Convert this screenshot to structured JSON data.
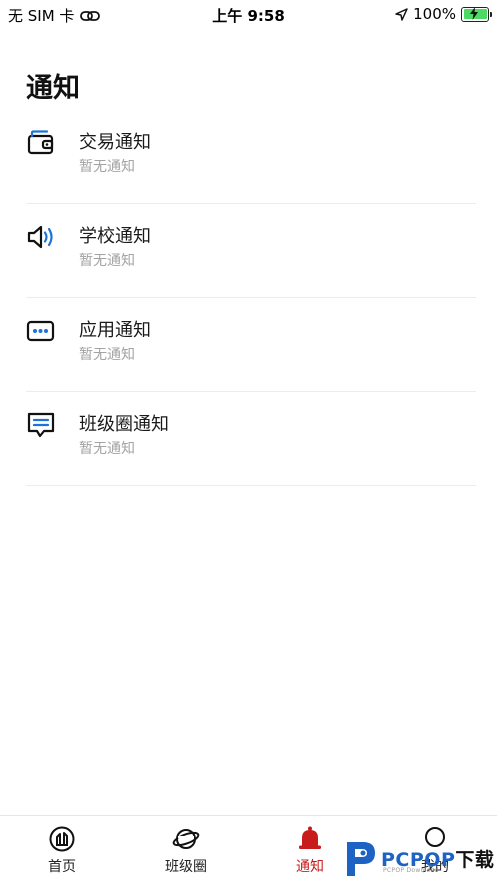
{
  "status_bar": {
    "carrier": "无 SIM 卡",
    "time": "上午 9:58",
    "battery": "100%"
  },
  "page": {
    "title": "通知"
  },
  "notifications": [
    {
      "name": "交易通知",
      "status": "暂无通知",
      "icon": "wallet-icon"
    },
    {
      "name": "学校通知",
      "status": "暂无通知",
      "icon": "speaker-icon"
    },
    {
      "name": "应用通知",
      "status": "暂无通知",
      "icon": "app-dots-icon"
    },
    {
      "name": "班级圈通知",
      "status": "暂无通知",
      "icon": "message-icon"
    }
  ],
  "tab_bar": {
    "tabs": [
      {
        "label": "首页",
        "icon": "home-icon"
      },
      {
        "label": "班级圈",
        "icon": "planet-icon"
      },
      {
        "label": "通知",
        "icon": "bell-icon",
        "active": true
      },
      {
        "label": "我的",
        "icon": "profile-icon"
      }
    ]
  },
  "watermark": {
    "brand": "PCPOP",
    "suffix": "下载",
    "small": "PCPOP Download"
  },
  "colors": {
    "accent": "#c81c1c",
    "icon_blue": "#1e73d8",
    "muted": "#a3a3a3",
    "watermark_blue": "#1e63c4"
  }
}
